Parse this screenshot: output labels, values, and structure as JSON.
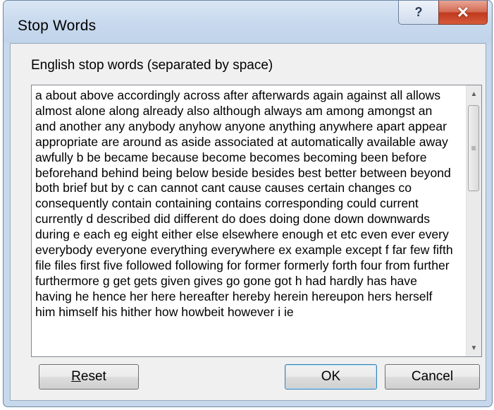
{
  "window": {
    "title": "Stop Words",
    "help_glyph": "?",
    "close_glyph": "✕"
  },
  "caption": "English stop words (separated by space)",
  "stop_words_text": "a about above accordingly across after afterwards again against all allows almost alone along already also although always am among amongst an and another any anybody anyhow anyone anything anywhere apart appear appropriate are around as aside associated at automatically available away awfully b be became because become becomes becoming been before beforehand behind being below beside besides best better between beyond both brief but by c can cannot cant cause causes certain changes co consequently contain containing contains corresponding could current currently d described did different do does doing done down downwards during e each eg eight either else elsewhere enough et etc even ever every everybody everyone everything everywhere ex example except f far few fifth file files first five followed following for former formerly forth four from further furthermore g get gets given gives go gone got h had hardly has have having he hence her here hereafter hereby herein hereupon hers herself him himself his hither how howbeit however i ie",
  "scrollbar": {
    "up_arrow": "▲",
    "down_arrow": "▼",
    "thumb_grip": "≡",
    "position_fraction": 0.0
  },
  "buttons": {
    "reset_mnemonic": "R",
    "reset_rest": "eset",
    "ok": "OK",
    "cancel": "Cancel"
  }
}
